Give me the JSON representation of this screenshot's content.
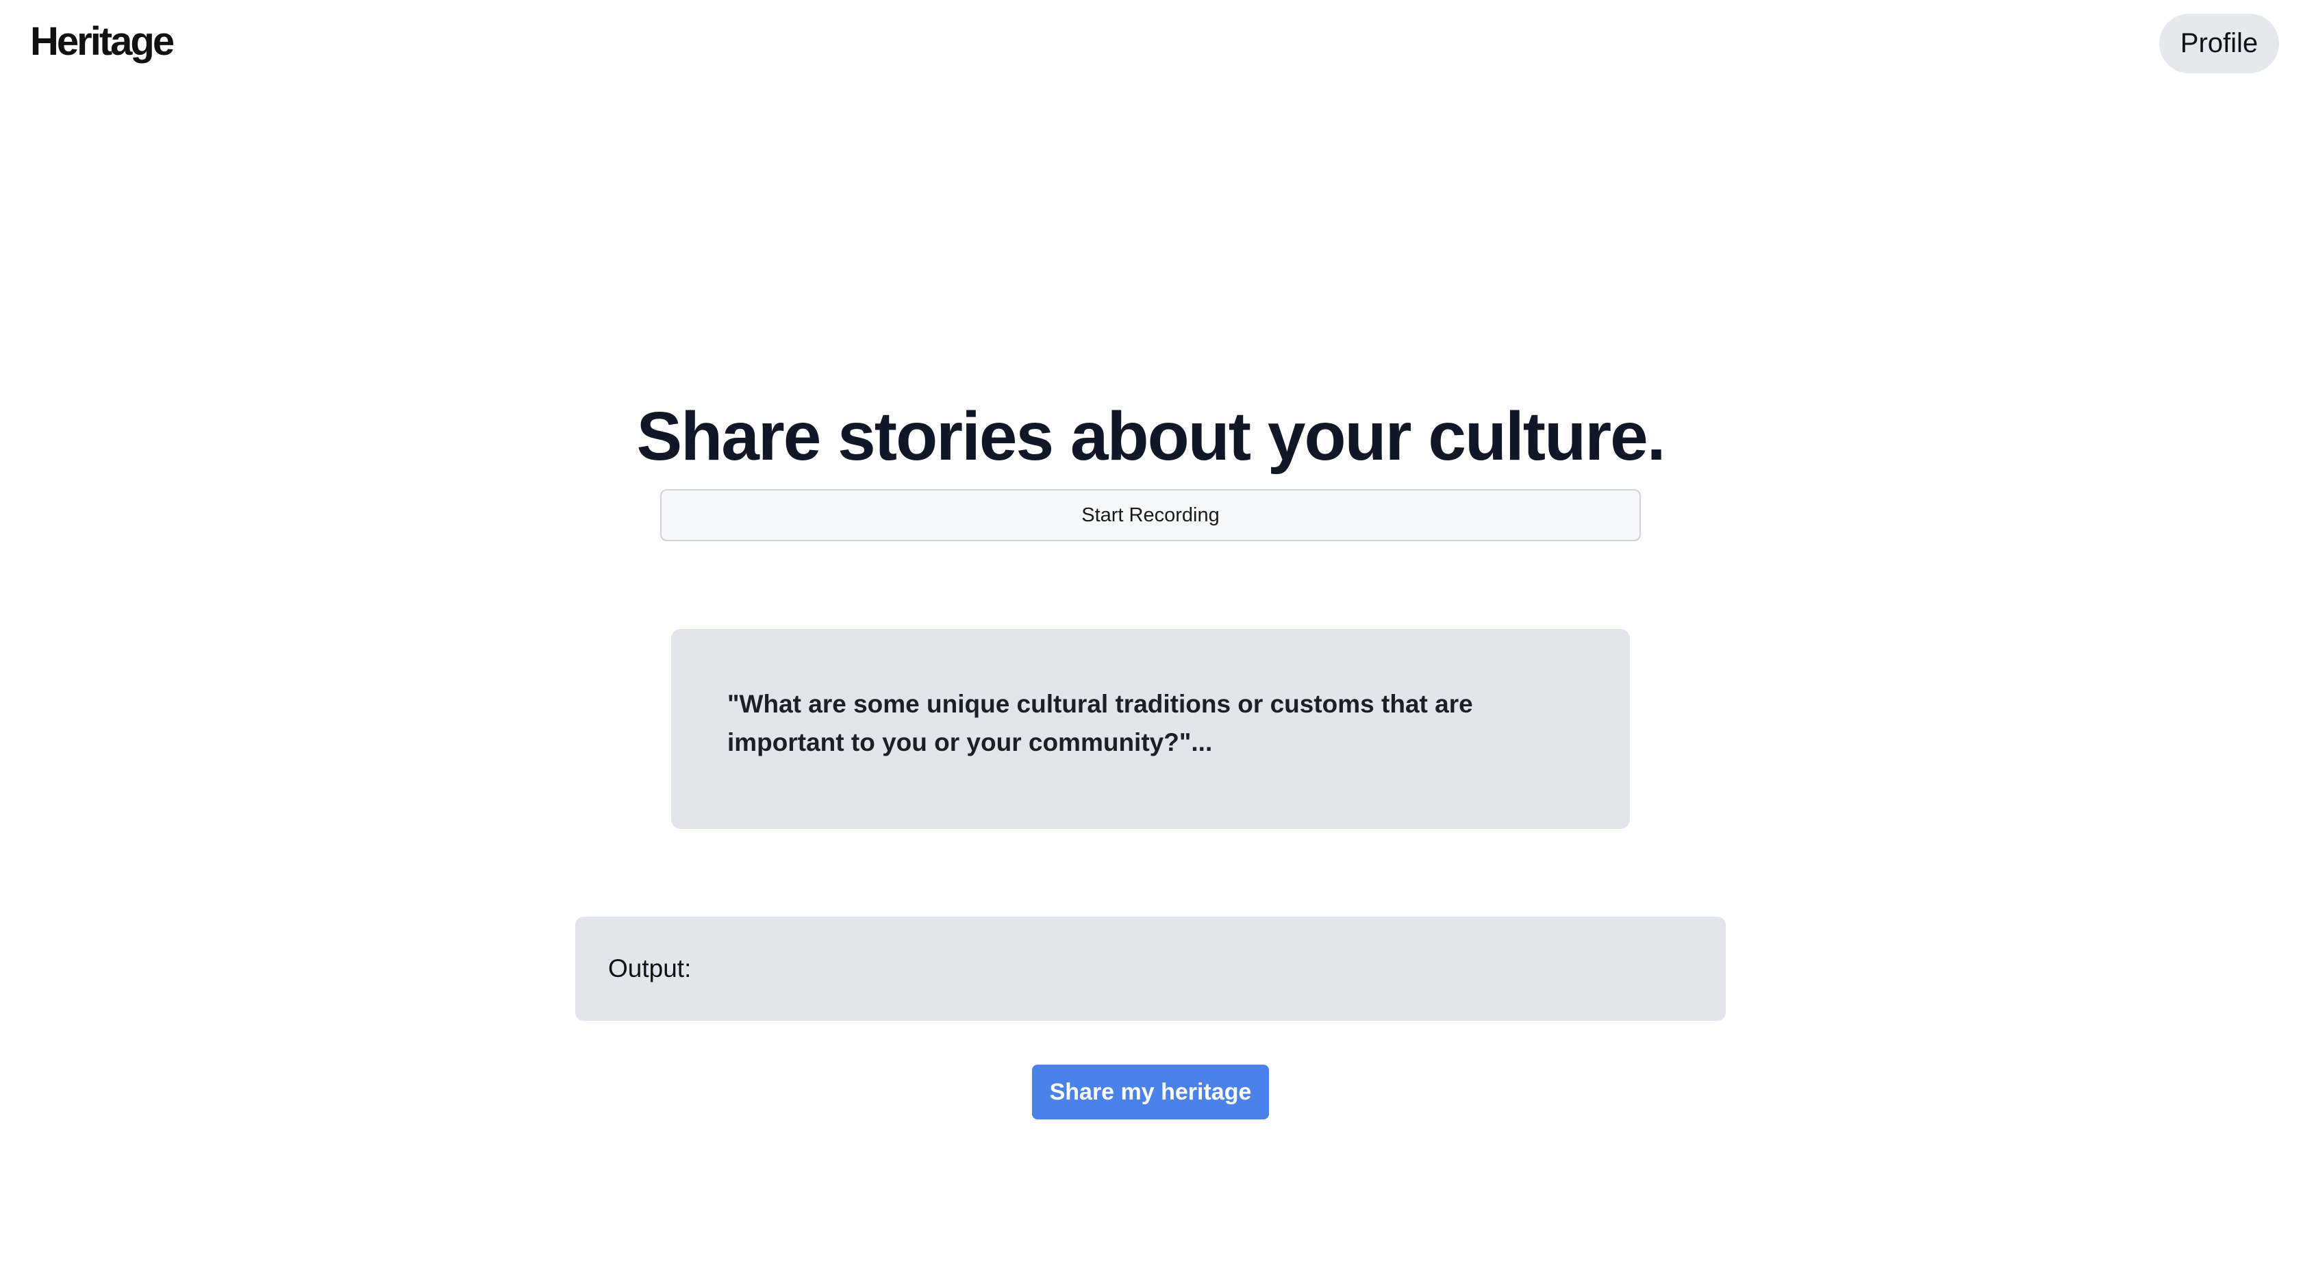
{
  "header": {
    "logo_text": "Heritage",
    "profile_label": "Profile"
  },
  "hero": {
    "title": "Share stories about your culture.",
    "record_label": "Start Recording"
  },
  "prompt": {
    "text": "\"What are some unique cultural traditions or customs that are important to you or your community?\"..."
  },
  "output": {
    "label": "Output:"
  },
  "actions": {
    "share_label": "Share my heritage"
  },
  "colors": {
    "accent": "#4b82ea",
    "card_background": "#e2e6ec",
    "title_text": "#101727"
  }
}
